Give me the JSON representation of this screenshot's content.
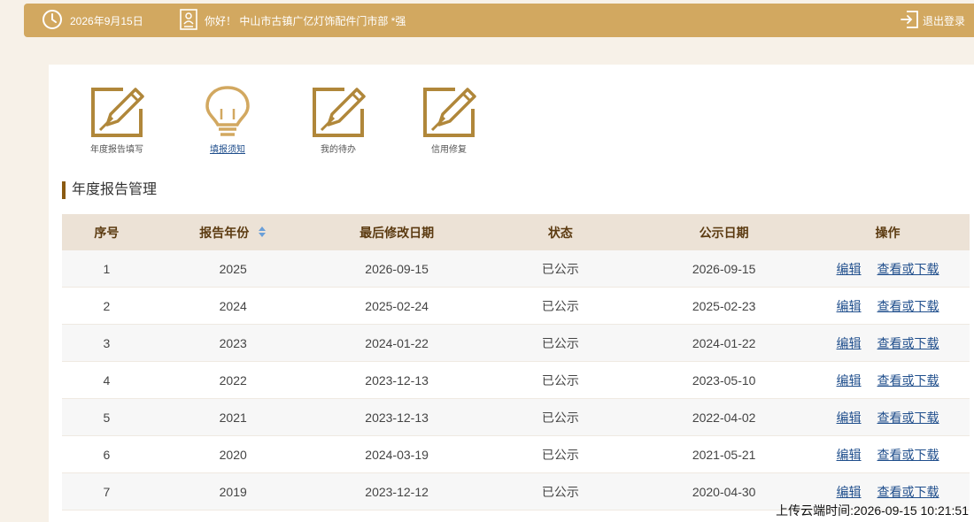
{
  "header": {
    "date": "2026年9月15日",
    "greeting": "你好！ 中山市古镇广亿灯饰配件门市部   *强",
    "logout_label": "退出登录",
    "icons": {
      "date": "clock-icon",
      "greeting": "user-card-icon",
      "logout": "logout-icon"
    }
  },
  "quick_links": [
    {
      "label": "年度报告填写",
      "icon": "edit-icon"
    },
    {
      "label": "填报须知",
      "icon": "lightbulb-icon"
    },
    {
      "label": "我的待办",
      "icon": "edit-icon"
    },
    {
      "label": "信用修复",
      "icon": "edit-icon"
    }
  ],
  "section_title": "年度报告管理",
  "table": {
    "headers": [
      "序号",
      "报告年份",
      "最后修改日期",
      "状态",
      "公示日期",
      "操作"
    ],
    "rows": [
      {
        "no": "1",
        "year": "2025",
        "modified": "2026-09-15",
        "status": "已公示",
        "published": "2026-09-15",
        "edit": "编辑",
        "view": "查看或下载"
      },
      {
        "no": "2",
        "year": "2024",
        "modified": "2025-02-24",
        "status": "已公示",
        "published": "2025-02-23",
        "edit": "编辑",
        "view": "查看或下载"
      },
      {
        "no": "3",
        "year": "2023",
        "modified": "2024-01-22",
        "status": "已公示",
        "published": "2024-01-22",
        "edit": "编辑",
        "view": "查看或下载"
      },
      {
        "no": "4",
        "year": "2022",
        "modified": "2023-12-13",
        "status": "已公示",
        "published": "2023-05-10",
        "edit": "编辑",
        "view": "查看或下载"
      },
      {
        "no": "5",
        "year": "2021",
        "modified": "2023-12-13",
        "status": "已公示",
        "published": "2022-04-02",
        "edit": "编辑",
        "view": "查看或下载"
      },
      {
        "no": "6",
        "year": "2020",
        "modified": "2024-03-19",
        "status": "已公示",
        "published": "2021-05-21",
        "edit": "编辑",
        "view": "查看或下载"
      },
      {
        "no": "7",
        "year": "2019",
        "modified": "2023-12-12",
        "status": "已公示",
        "published": "2020-04-30",
        "edit": "编辑",
        "view": "查看或下载"
      }
    ]
  },
  "upload_time": "上传云端时间:2026-09-15 10:21:51",
  "colors": {
    "header_bg": "#d2a860",
    "accent": "#b0873a",
    "link": "#1f4e8c",
    "table_header_bg": "#ece2d6"
  }
}
